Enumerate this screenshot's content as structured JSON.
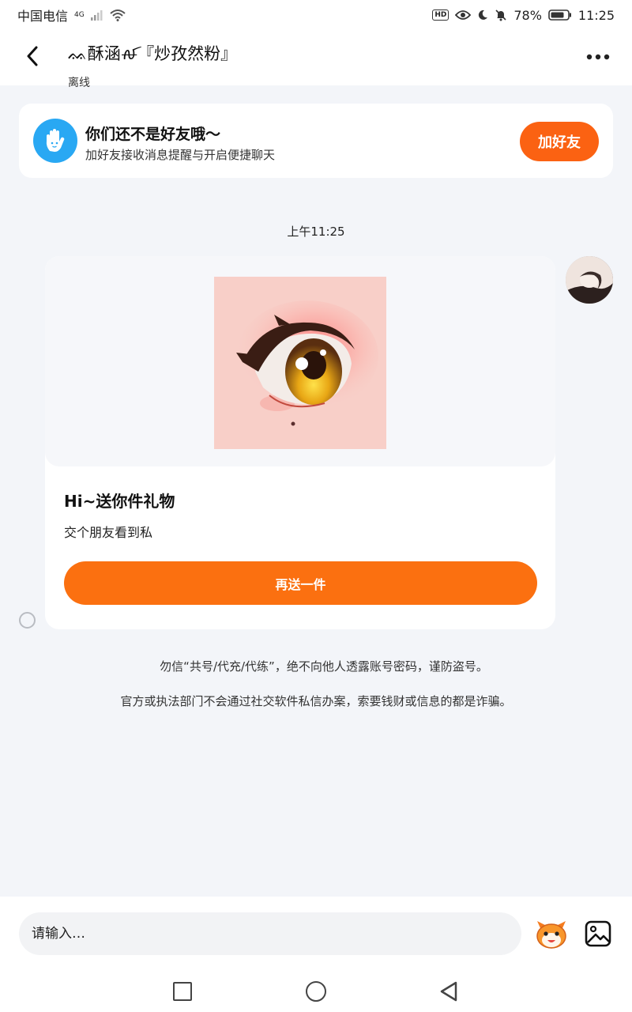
{
  "status_bar": {
    "carrier": "中国电信",
    "network": "4G",
    "battery": "78%",
    "time": "11:25",
    "hd": "HD"
  },
  "header": {
    "title": "ᨐ酥涵ꫛ『炒孜然粉』",
    "subtitle": "离线",
    "back_icon": "chevron-left-icon",
    "more_icon": "more-dots-icon"
  },
  "friend_banner": {
    "title": "你们还不是好友哦～",
    "subtitle": "加好友接收消息提醒与开启便捷聊天",
    "button_label": "加好友",
    "icon": "wave-hand-icon"
  },
  "timestamp": "上午11:25",
  "gift_card": {
    "title": "Hi~送你件礼物",
    "description": "交个朋友看到私",
    "button_label": "再送一件"
  },
  "notices": [
    "勿信“共号/代充/代练”，绝不向他人透露账号密码，谨防盗号。",
    "官方或执法部门不会通过社交软件私信办案，索要钱财或信息的都是诈骗。"
  ],
  "input_bar": {
    "placeholder": "请输入…",
    "emoji_icon": "emoji-icon",
    "image_icon": "image-icon"
  },
  "colors": {
    "accent": "#fb6212",
    "button_orange": "#fb7010",
    "hand_icon_bg": "#29a8f3",
    "background": "#f3f5f9"
  }
}
